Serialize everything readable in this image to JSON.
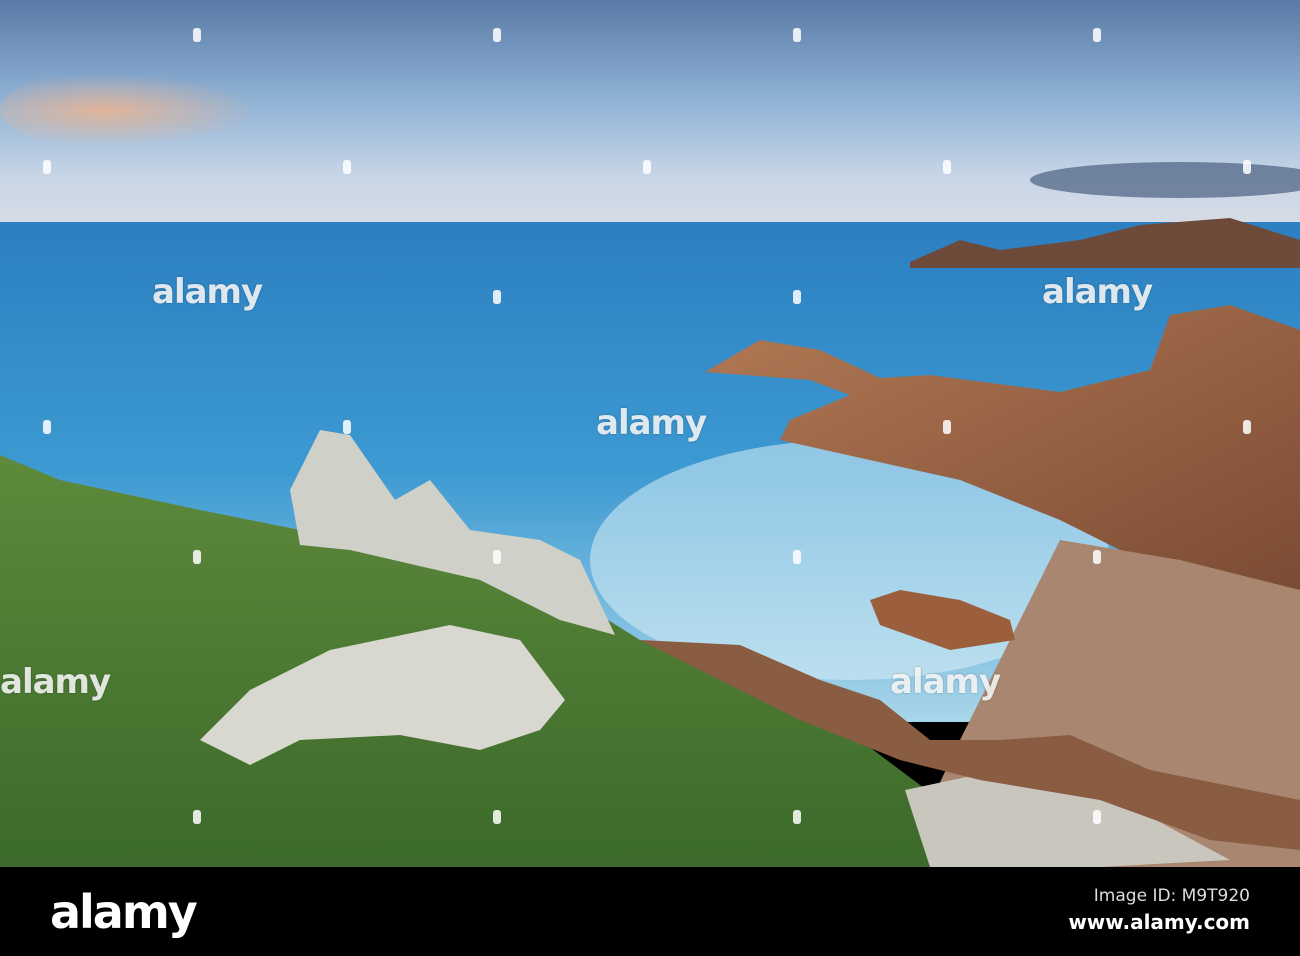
{
  "photo": {
    "watermark": "alamy"
  },
  "footer": {
    "logo": "alamy",
    "image_id": "Image ID: M9T920",
    "website": "www.alamy.com"
  },
  "colors": {
    "sky_top": "#5d7ea8",
    "sea": "#3f9bd3",
    "grass": "#4f7a34",
    "rock": "#9a6446",
    "bar": "#000000"
  }
}
